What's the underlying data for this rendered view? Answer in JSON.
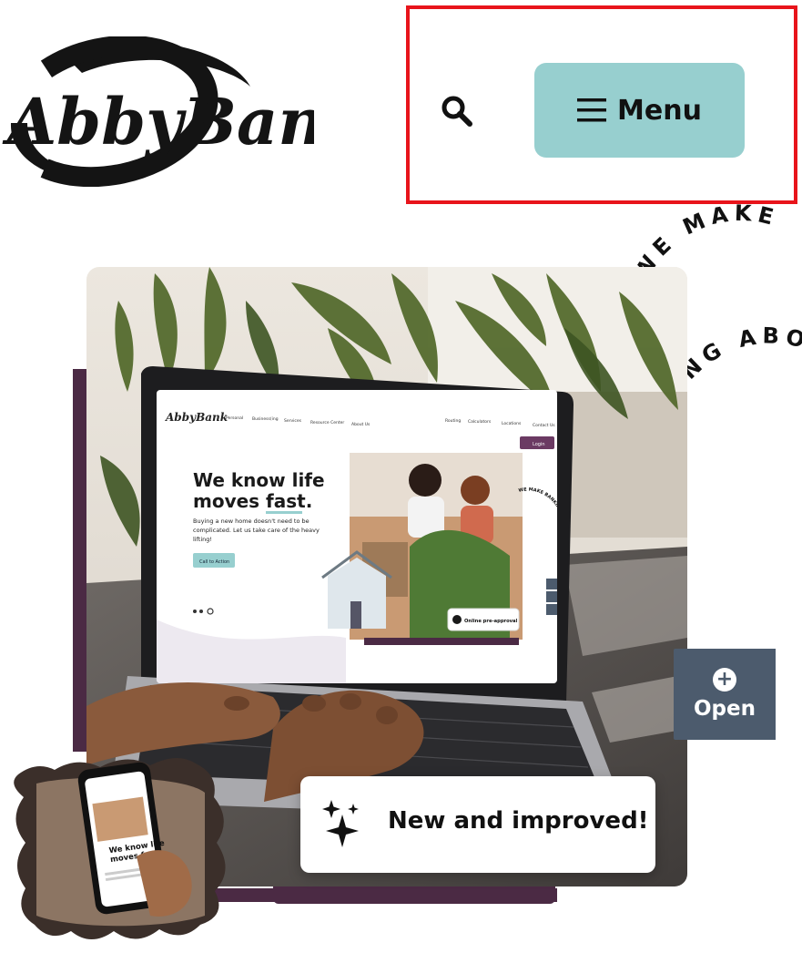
{
  "header": {
    "logo_text": "AbbyBank",
    "search_label": "Search",
    "menu_label": "Menu"
  },
  "hero": {
    "circle_text_top": "WE MAKE",
    "circle_text_bottom": "ING ABO",
    "laptop_screen": {
      "logo": "AbbyBank",
      "nav": [
        "Personal",
        "Business(ing",
        "Services",
        "Resource Center",
        "About Us"
      ],
      "utility": [
        "Routing",
        "Calculators",
        "Locations",
        "Contact Us"
      ],
      "login": "Login",
      "headline_line1": "We know life",
      "headline_line2": "moves fast.",
      "body_line1": "Buying a new home doesn't need to be",
      "body_line2": "complicated. Let us take care of the heavy",
      "body_line3": "lifting!",
      "cta": "Call to Action",
      "ring_text": "WE MAKE BANKING ABO",
      "pill": "Online pre-approval"
    },
    "phone_screen": {
      "headline_line1": "We know life",
      "headline_line2": "moves fast."
    },
    "badge_text": "New and improved!",
    "open_label": "Open"
  },
  "colors": {
    "menu_bg": "#97cfcf",
    "highlight": "#e8141b",
    "open_tab_bg": "#4c5b6d",
    "purple": "#4b2a44",
    "login_btn": "#6b3a63"
  }
}
